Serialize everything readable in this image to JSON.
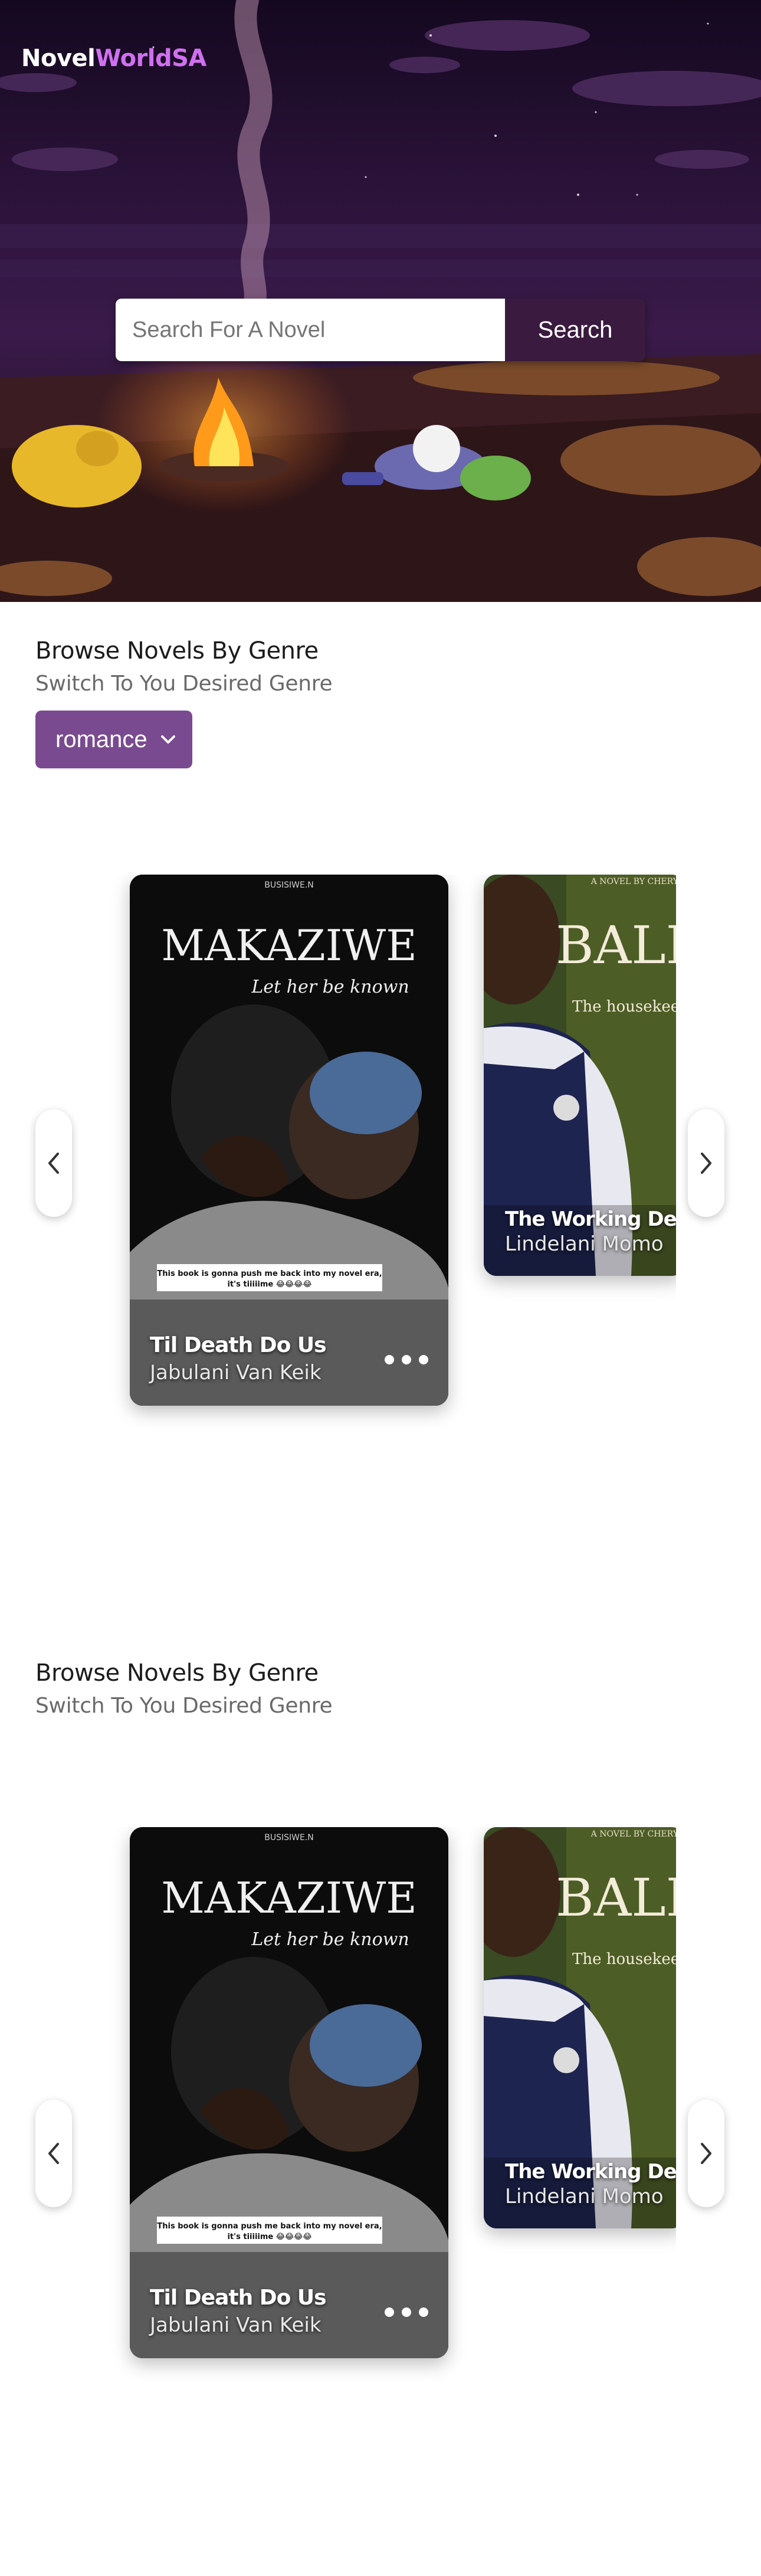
{
  "header": {
    "logo_part1": "Novel",
    "logo_part2": "WorldSA"
  },
  "search": {
    "placeholder": "Search For A Novel",
    "value": "",
    "button_label": "Search"
  },
  "sections": [
    {
      "title": "Browse Novels By Genre",
      "subtitle": "Switch To You Desired Genre",
      "genre_selected": "romance",
      "books": [
        {
          "title": "Til Death Do Us",
          "author": "Jabulani Van Keik",
          "cover_author": "BUSISIWE.N",
          "cover_title": "MAKAZIWE",
          "cover_tagline": "Let her be known",
          "cover_sticker_line1": "This book is gonna push me back into my novel era,",
          "cover_sticker_line2": "it's tiiiiime 😂😂😂😂"
        },
        {
          "title": "The Working Deed",
          "author": "Lindelani Momo",
          "cover_byline": "A NOVEL BY CHERY",
          "cover_title": "BALE",
          "cover_subtitle": "The housekee"
        }
      ]
    },
    {
      "title": "Browse Novels By Genre",
      "subtitle": "Switch To You Desired Genre",
      "books": [
        {
          "title": "Til Death Do Us",
          "author": "Jabulani Van Keik",
          "cover_author": "BUSISIWE.N",
          "cover_title": "MAKAZIWE",
          "cover_tagline": "Let her be known",
          "cover_sticker_line1": "This book is gonna push me back into my novel era,",
          "cover_sticker_line2": "it's tiiiiime 😂😂😂😂"
        },
        {
          "title": "The Working Deed",
          "author": "Lindelani Momo",
          "cover_byline": "A NOVEL BY CHERY",
          "cover_title": "BALE",
          "cover_subtitle": "The housekee"
        }
      ]
    }
  ],
  "icons": {
    "prev": "chevron-left-icon",
    "next": "chevron-right-icon",
    "dropdown": "chevron-down-icon",
    "more": "more-horizontal-icon"
  },
  "colors": {
    "brand_accent": "#d070f0",
    "search_button": "#3a1a3e",
    "genre_select": "#7a4a90"
  }
}
